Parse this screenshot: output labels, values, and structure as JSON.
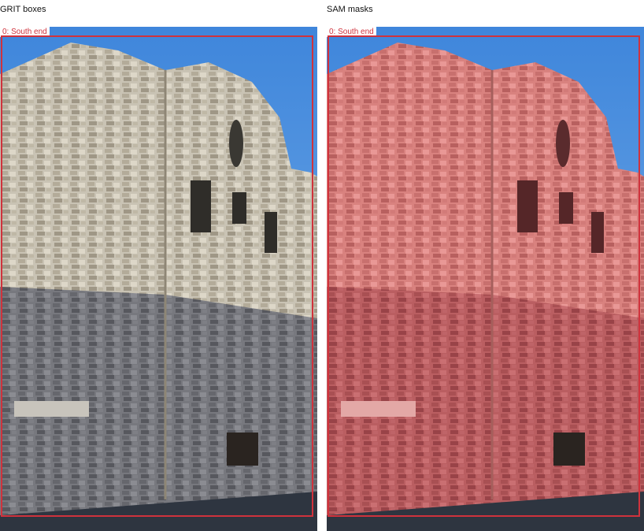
{
  "panels": [
    {
      "title": "GRIT boxes",
      "box_label": "0: South end"
    },
    {
      "title": "SAM masks",
      "box_label": "0: South end"
    }
  ],
  "colors": {
    "accent": "#d0323c",
    "mask": "#e8474f",
    "sky": "#4a90d9"
  }
}
